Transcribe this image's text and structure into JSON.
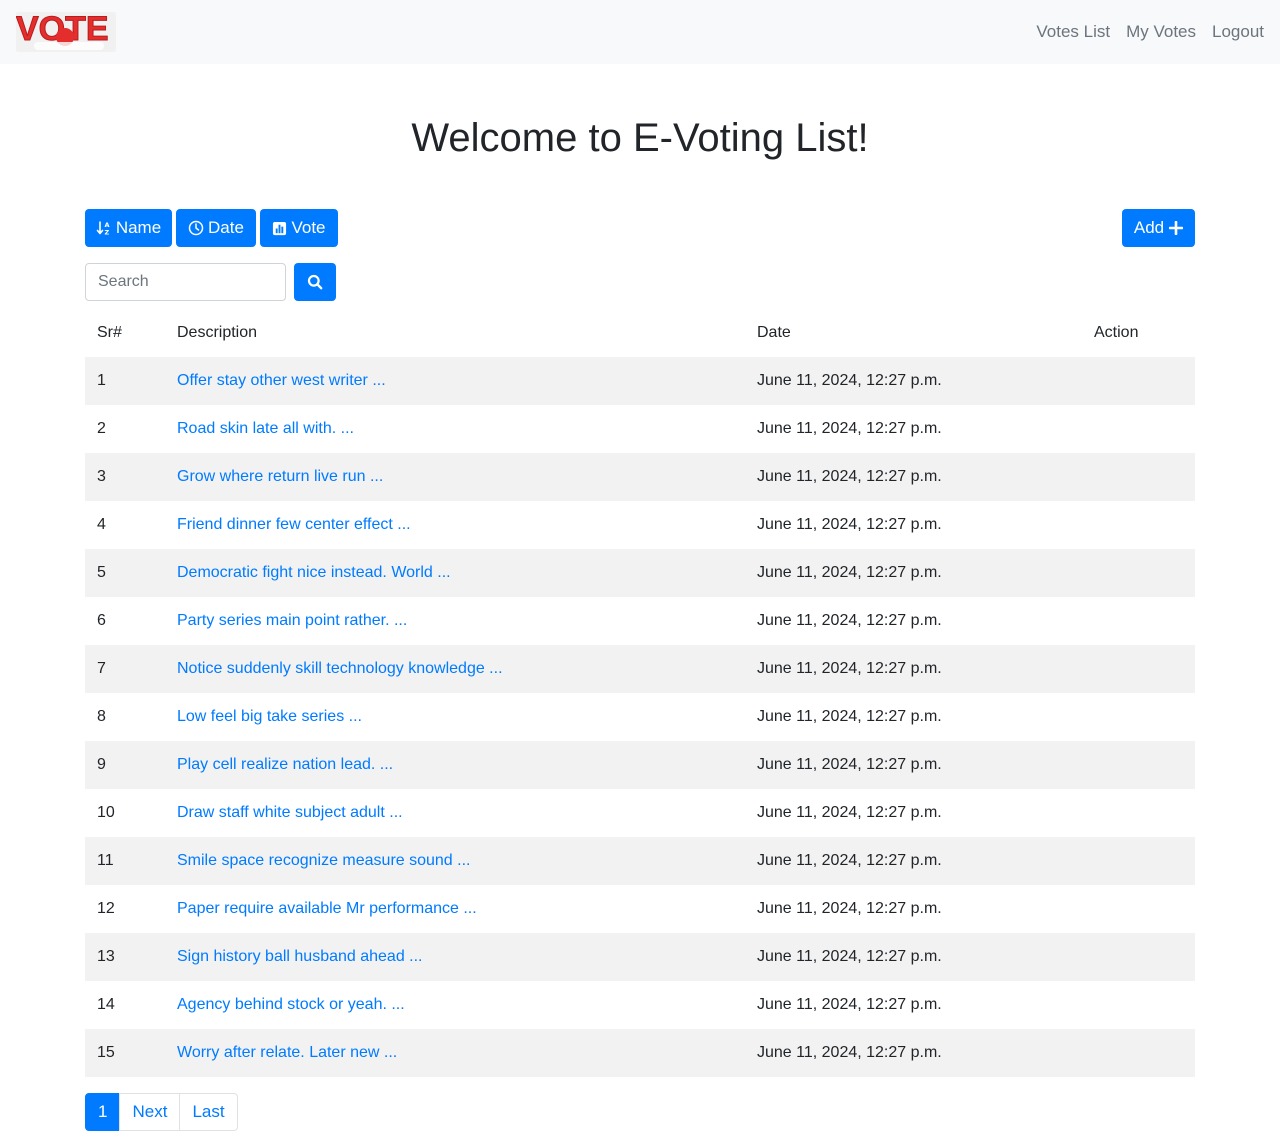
{
  "navbar": {
    "brand": "VOTE",
    "links": [
      "Votes List",
      "My Votes",
      "Logout"
    ]
  },
  "page_title": "Welcome to E-Voting List!",
  "toolbar": {
    "sort_name_label": "Name",
    "sort_date_label": "Date",
    "sort_vote_label": "Vote",
    "add_label": "Add"
  },
  "search": {
    "placeholder": "Search",
    "value": ""
  },
  "table": {
    "headers": [
      "Sr#",
      "Description",
      "Date",
      "Action"
    ],
    "rows": [
      {
        "sr": "1",
        "description": "Offer stay other west writer ...",
        "date": "June 11, 2024, 12:27 p.m."
      },
      {
        "sr": "2",
        "description": "Road skin late all with. ...",
        "date": "June 11, 2024, 12:27 p.m."
      },
      {
        "sr": "3",
        "description": "Grow where return live run ...",
        "date": "June 11, 2024, 12:27 p.m."
      },
      {
        "sr": "4",
        "description": "Friend dinner few center effect ...",
        "date": "June 11, 2024, 12:27 p.m."
      },
      {
        "sr": "5",
        "description": "Democratic fight nice instead. World ...",
        "date": "June 11, 2024, 12:27 p.m."
      },
      {
        "sr": "6",
        "description": "Party series main point rather. ...",
        "date": "June 11, 2024, 12:27 p.m."
      },
      {
        "sr": "7",
        "description": "Notice suddenly skill technology knowledge ...",
        "date": "June 11, 2024, 12:27 p.m."
      },
      {
        "sr": "8",
        "description": "Low feel big take series ...",
        "date": "June 11, 2024, 12:27 p.m."
      },
      {
        "sr": "9",
        "description": "Play cell realize nation lead. ...",
        "date": "June 11, 2024, 12:27 p.m."
      },
      {
        "sr": "10",
        "description": "Draw staff white subject adult ...",
        "date": "June 11, 2024, 12:27 p.m."
      },
      {
        "sr": "11",
        "description": "Smile space recognize measure sound ...",
        "date": "June 11, 2024, 12:27 p.m."
      },
      {
        "sr": "12",
        "description": "Paper require available Mr performance ...",
        "date": "June 11, 2024, 12:27 p.m."
      },
      {
        "sr": "13",
        "description": "Sign history ball husband ahead ...",
        "date": "June 11, 2024, 12:27 p.m."
      },
      {
        "sr": "14",
        "description": "Agency behind stock or yeah. ...",
        "date": "June 11, 2024, 12:27 p.m."
      },
      {
        "sr": "15",
        "description": "Worry after relate. Later new ...",
        "date": "June 11, 2024, 12:27 p.m."
      }
    ]
  },
  "pagination": {
    "current": "1",
    "next_label": "Next",
    "last_label": "Last"
  },
  "colors": {
    "primary": "#007bff",
    "navbar_bg": "#f8f9fa",
    "nav_link": "#6c757d",
    "row_stripe": "#f2f2f2",
    "brand_red": "#e42d2d"
  }
}
